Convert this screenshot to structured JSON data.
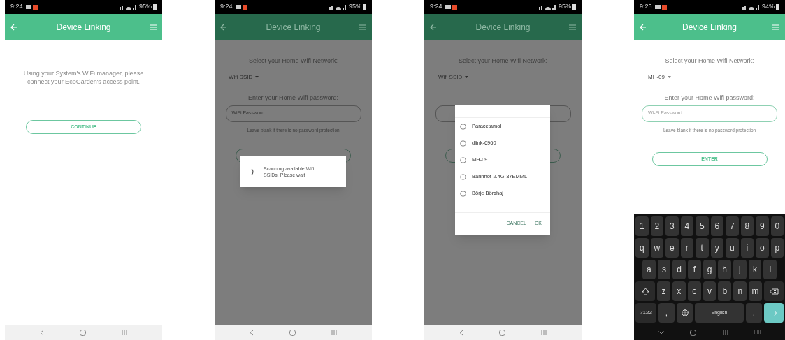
{
  "phones": [
    {
      "status": {
        "time": "9:24",
        "battery": "95%"
      },
      "app_bar": {
        "title": "Device Linking"
      },
      "dimmed": false,
      "screen": {
        "kind": "instructions",
        "message": "Using your System's WiFi manager, please connect your EcoGarden's access point.",
        "button": "CONTINUE"
      }
    },
    {
      "status": {
        "time": "9:24",
        "battery": "95%"
      },
      "app_bar": {
        "title": "Device Linking"
      },
      "dimmed": true,
      "screen": {
        "kind": "form",
        "network_prompt": "Select your Home Wifi Network:",
        "ssid": "Wifi SSID",
        "password_prompt": "Enter your Home Wifi password:",
        "password_placeholder": "WiFi Password",
        "hint": "Leave blank if there is no password protection"
      },
      "dialog": {
        "kind": "progress",
        "message": "Scanning available Wifi SSIDs. Please wait"
      }
    },
    {
      "status": {
        "time": "9:24",
        "battery": "95%"
      },
      "app_bar": {
        "title": "Device Linking"
      },
      "dimmed": true,
      "screen": {
        "kind": "form",
        "network_prompt": "Select your Home Wifi Network:",
        "ssid": "Wifi SSID"
      },
      "dialog": {
        "kind": "choice",
        "options": [
          {
            "label": "Paracetamol",
            "selected": false
          },
          {
            "label": "dlink-6960",
            "selected": false
          },
          {
            "label": "MH-09",
            "selected": false
          },
          {
            "label": "Bahnhof-2.4G-37EMML",
            "selected": false
          },
          {
            "label": "Börje Börshaj",
            "selected": false
          }
        ],
        "buttons": [
          "CANCEL",
          "OK"
        ]
      }
    },
    {
      "status": {
        "time": "9:25",
        "battery": "94%"
      },
      "app_bar": {
        "title": "Device Linking"
      },
      "dimmed": false,
      "screen": {
        "kind": "form",
        "network_prompt": "Select your Home Wifi Network:",
        "ssid": "MH-09",
        "password_prompt": "Enter your Home Wifi password:",
        "password_placeholder": "Wi-Fi Password",
        "hint": "Leave blank if there is no password protection",
        "button": "ENTER"
      },
      "keyboard": {
        "rows": [
          {
            "keys": [
              {
                "kind": "char",
                "label": "1"
              },
              {
                "kind": "char",
                "label": "2"
              },
              {
                "kind": "char",
                "label": "3"
              },
              {
                "kind": "char",
                "label": "4"
              },
              {
                "kind": "char",
                "label": "5"
              },
              {
                "kind": "char",
                "label": "6"
              },
              {
                "kind": "char",
                "label": "7"
              },
              {
                "kind": "char",
                "label": "8"
              },
              {
                "kind": "char",
                "label": "9"
              },
              {
                "kind": "char",
                "label": "0"
              }
            ]
          },
          {
            "keys": [
              {
                "kind": "char",
                "label": "q"
              },
              {
                "kind": "char",
                "label": "w"
              },
              {
                "kind": "char",
                "label": "e"
              },
              {
                "kind": "char",
                "label": "r"
              },
              {
                "kind": "char",
                "label": "t"
              },
              {
                "kind": "char",
                "label": "y"
              },
              {
                "kind": "char",
                "label": "u"
              },
              {
                "kind": "char",
                "label": "i"
              },
              {
                "kind": "char",
                "label": "o"
              },
              {
                "kind": "char",
                "label": "p"
              }
            ]
          },
          {
            "keys": [
              {
                "kind": "char",
                "label": "a"
              },
              {
                "kind": "char",
                "label": "s"
              },
              {
                "kind": "char",
                "label": "d"
              },
              {
                "kind": "char",
                "label": "f"
              },
              {
                "kind": "char",
                "label": "g"
              },
              {
                "kind": "char",
                "label": "h"
              },
              {
                "kind": "char",
                "label": "j"
              },
              {
                "kind": "char",
                "label": "k"
              },
              {
                "kind": "char",
                "label": "l"
              }
            ]
          },
          {
            "keys": [
              {
                "kind": "shift"
              },
              {
                "kind": "char",
                "label": "z"
              },
              {
                "kind": "char",
                "label": "x"
              },
              {
                "kind": "char",
                "label": "c"
              },
              {
                "kind": "char",
                "label": "v"
              },
              {
                "kind": "char",
                "label": "b"
              },
              {
                "kind": "char",
                "label": "n"
              },
              {
                "kind": "char",
                "label": "m"
              },
              {
                "kind": "backspace"
              }
            ]
          },
          {
            "keys": [
              {
                "kind": "label",
                "label": "?123"
              },
              {
                "kind": "char",
                "label": ","
              },
              {
                "kind": "globe"
              },
              {
                "kind": "space",
                "label": "English"
              },
              {
                "kind": "char",
                "label": "."
              },
              {
                "kind": "enter"
              }
            ]
          }
        ]
      }
    }
  ]
}
